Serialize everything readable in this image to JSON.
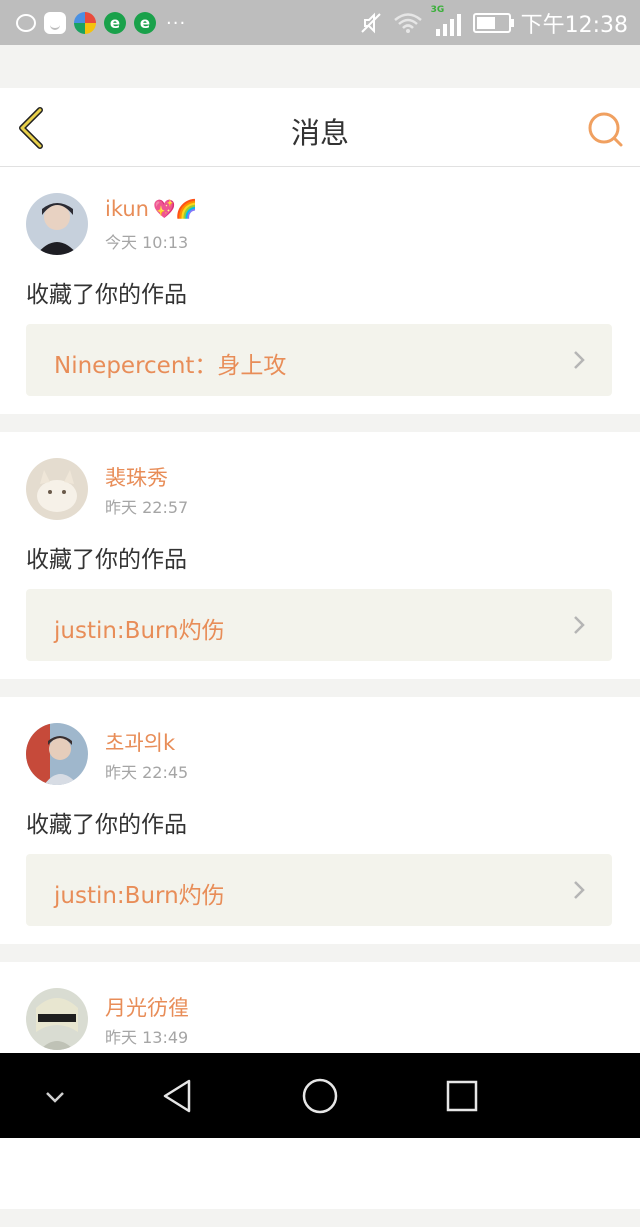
{
  "status_bar": {
    "time": "下午12:38",
    "network": "3G",
    "overflow": "···"
  },
  "header": {
    "title": "消息"
  },
  "feed": [
    {
      "username": "ikun",
      "username_emoji": "💖🌈",
      "time": "今天 10:13",
      "action": "收藏了你的作品",
      "work_title": "Ninepercent：身上攻"
    },
    {
      "username": "裴珠秀",
      "username_emoji": "",
      "time": "昨天 22:57",
      "action": "收藏了你的作品",
      "work_title": "justin:Burn灼伤"
    },
    {
      "username": "초과의k",
      "username_emoji": "",
      "time": "昨天 22:45",
      "action": "收藏了你的作品",
      "work_title": "justin:Burn灼伤"
    },
    {
      "username": "月光彷徨",
      "username_emoji": "",
      "time": "昨天 13:49",
      "action": "",
      "work_title": ""
    }
  ],
  "colors": {
    "accent": "#e88d58",
    "back_arrow": "#e8d04a",
    "status_bar_bg": "#bdbdbd"
  },
  "icons": {
    "back": "chevron-left-icon",
    "search": "search-icon",
    "nav_down": "chevron-down-icon",
    "nav_back": "triangle-back-icon",
    "nav_home": "circle-home-icon",
    "nav_recent": "square-recent-icon"
  }
}
